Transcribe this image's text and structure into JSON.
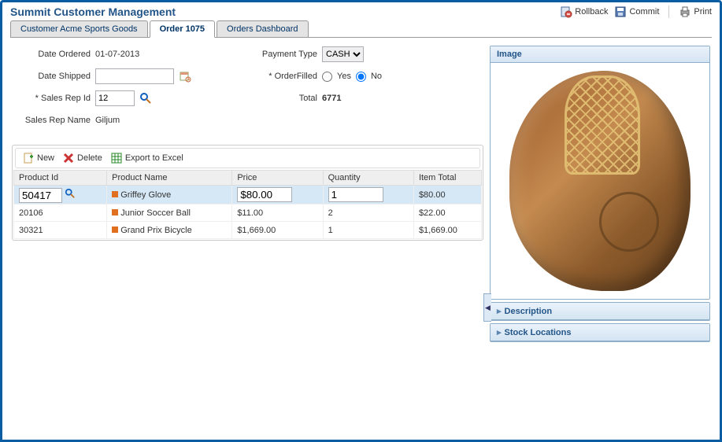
{
  "app_title": "Summit Customer Management",
  "toolbar": {
    "rollback": "Rollback",
    "commit": "Commit",
    "print": "Print"
  },
  "tabs": [
    {
      "label": "Customer Acme Sports Goods",
      "active": false
    },
    {
      "label": "Order 1075",
      "active": true
    },
    {
      "label": "Orders Dashboard",
      "active": false
    }
  ],
  "order_form": {
    "date_ordered_label": "Date Ordered",
    "date_ordered": "01-07-2013",
    "date_shipped_label": "Date Shipped",
    "date_shipped": "",
    "sales_rep_id_label": "* Sales Rep Id",
    "sales_rep_id": "12",
    "sales_rep_name_label": "Sales Rep Name",
    "sales_rep_name": "Giljum",
    "payment_type_label": "Payment Type",
    "payment_type": "CASH",
    "order_filled_label": "* OrderFilled",
    "order_filled_yes": "Yes",
    "order_filled_no": "No",
    "order_filled": "No",
    "total_label": "Total",
    "total": "6771"
  },
  "grid": {
    "actions": {
      "new": "New",
      "delete": "Delete",
      "export": "Export to Excel"
    },
    "columns": [
      "Product Id",
      "Product Name",
      "Price",
      "Quantity",
      "Item Total"
    ],
    "rows": [
      {
        "product_id": "50417",
        "product_name": "Griffey Glove",
        "price": "$80.00",
        "quantity": "1",
        "item_total": "$80.00",
        "selected": true
      },
      {
        "product_id": "20106",
        "product_name": "Junior Soccer Ball",
        "price": "$11.00",
        "quantity": "2",
        "item_total": "$22.00",
        "selected": false
      },
      {
        "product_id": "30321",
        "product_name": "Grand Prix Bicycle",
        "price": "$1,669.00",
        "quantity": "1",
        "item_total": "$1,669.00",
        "selected": false
      }
    ]
  },
  "sidebar": {
    "image_title": "Image",
    "description_title": "Description",
    "stock_title": "Stock Locations"
  }
}
